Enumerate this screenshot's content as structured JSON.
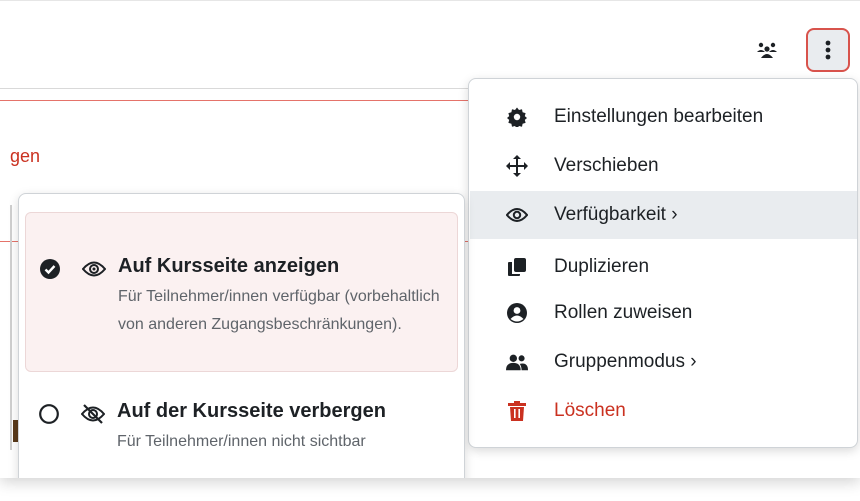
{
  "page": {
    "partial_link_text": "gen"
  },
  "toolbar": {
    "people_icon": "groups-icon",
    "kebab_icon": "vertical-ellipsis-icon"
  },
  "menu": {
    "items": [
      {
        "label": "Einstellungen bearbeiten",
        "icon": "gear-icon"
      },
      {
        "label": "Verschieben",
        "icon": "move-arrows-icon"
      },
      {
        "label": "Verfügbarkeit",
        "icon": "eye-icon",
        "has_submenu": true
      },
      {
        "label": "Duplizieren",
        "icon": "copy-icon"
      },
      {
        "label": "Rollen zuweisen",
        "icon": "user-circle-icon"
      },
      {
        "label": "Gruppenmodus",
        "icon": "users-icon",
        "has_submenu": true
      },
      {
        "label": "Löschen",
        "icon": "trash-icon",
        "color": "#ca3120"
      }
    ],
    "submenu_chevron": "›"
  },
  "availability_submenu": {
    "options": [
      {
        "title": "Auf Kursseite anzeigen",
        "description": "Für Teilnehmer/innen verfügbar (vorbehaltlich von anderen Zugangsbeschränkungen).",
        "selected": true
      },
      {
        "title": "Auf der Kursseite verbergen",
        "description": "Für Teilnehmer/innen nicht sichtbar",
        "selected": false
      }
    ]
  },
  "colors": {
    "accent_red": "#ca3120",
    "active_bg": "#e9ecef",
    "selected_bg": "#fbf1f1"
  }
}
